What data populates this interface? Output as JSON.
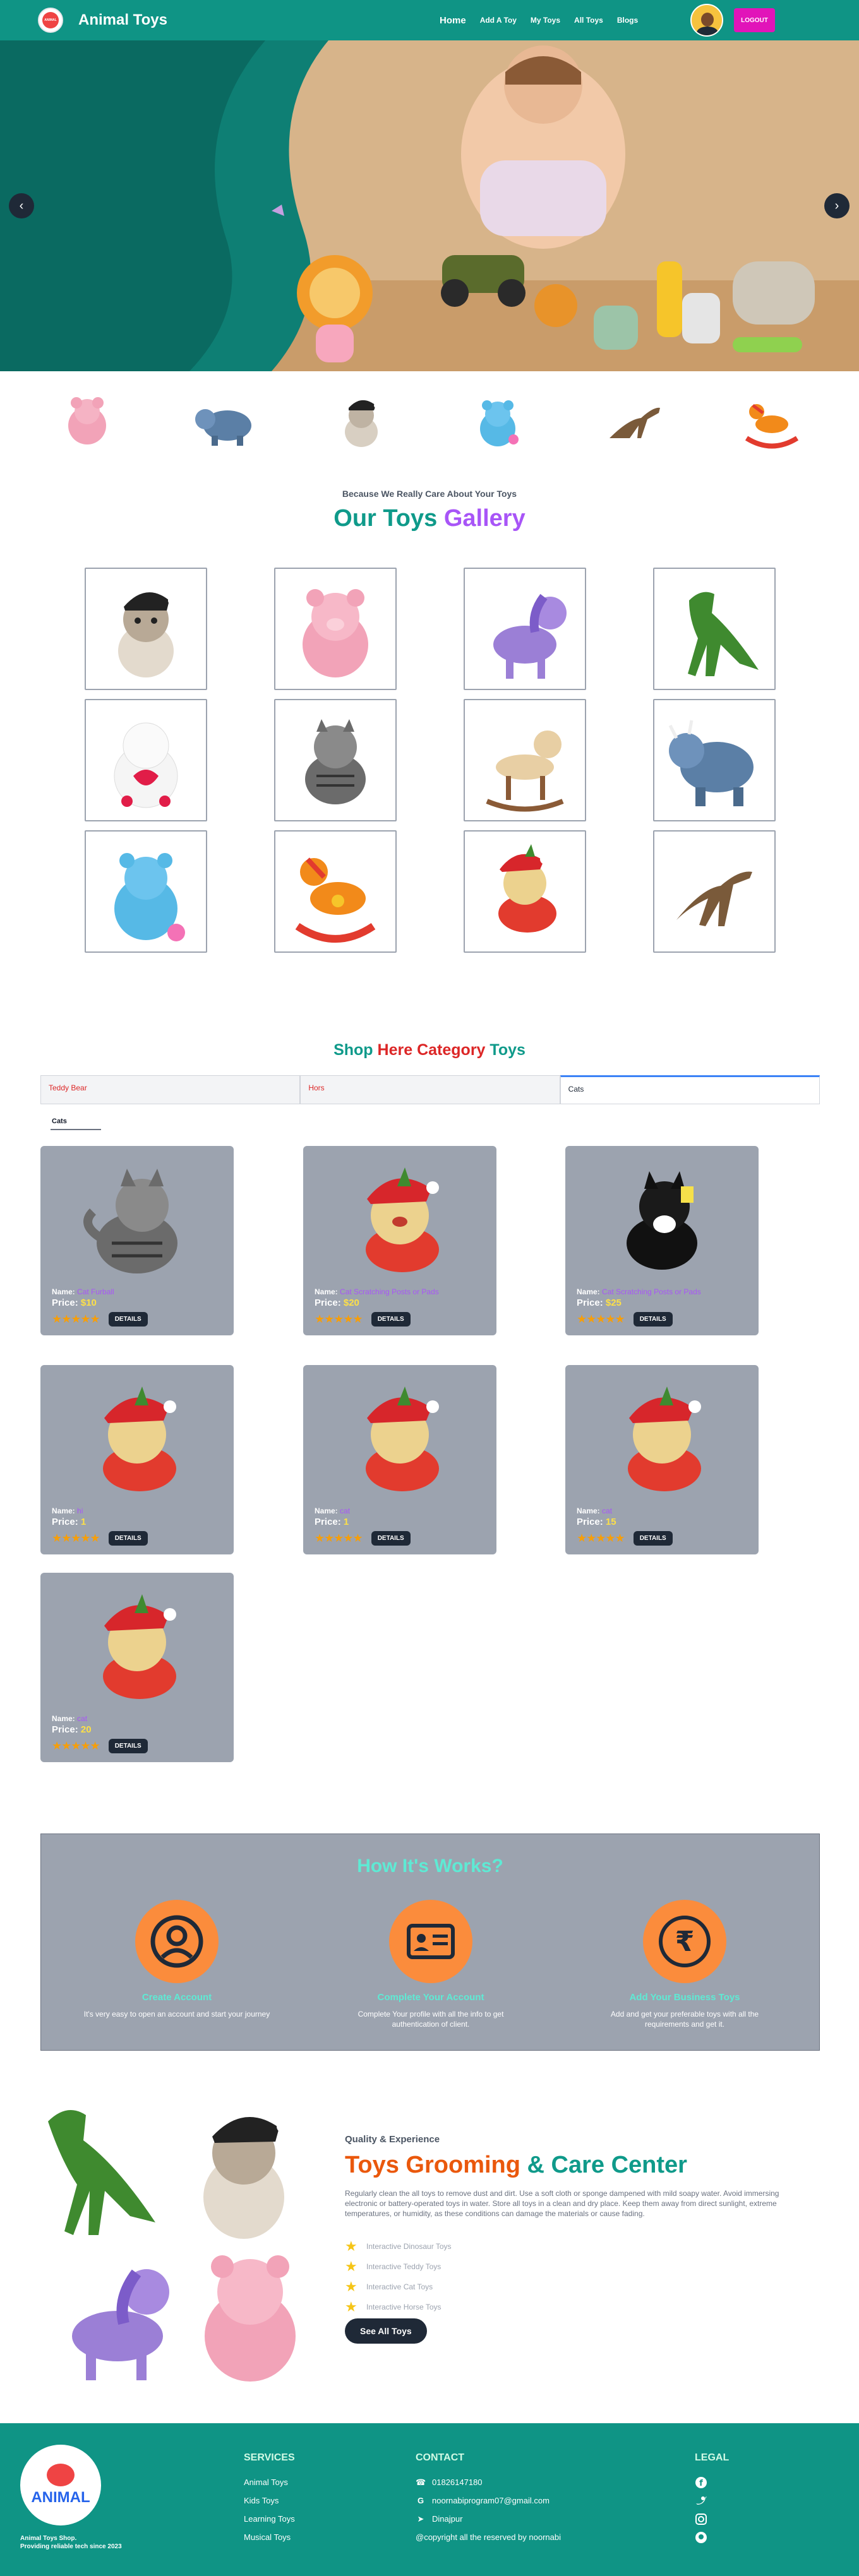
{
  "nav": {
    "brand": "Animal Toys",
    "logo_text": "ANIMAL",
    "links": [
      "Home",
      "Add A Toy",
      "My Toys",
      "All Toys",
      "Blogs"
    ],
    "logout": "LOGOUT"
  },
  "hero": {
    "prev": "‹",
    "next": "›"
  },
  "gallery": {
    "eyebrow": "Because We Really Care About Your Toys",
    "title_a": "Our Toys",
    "title_b": "Gallery"
  },
  "category": {
    "title_a": "Shop",
    "title_b": "Here Category",
    "title_c": "Toys",
    "tabs": [
      "Teddy Bear",
      "Hors",
      "Cats"
    ],
    "subtab": "Cats",
    "cards": [
      {
        "name_label": "Name:",
        "name": "Cat Furball",
        "price_label": "Price:",
        "price": "$10",
        "details": "DETAILS",
        "stars": "★★★★★"
      },
      {
        "name_label": "Name:",
        "name": "Cat Scratching Posts or Pads",
        "price_label": "Price:",
        "price": "$20",
        "details": "DETAILS",
        "stars": "★★★★★"
      },
      {
        "name_label": "Name:",
        "name": "Cat Scratching Posts or Pads",
        "price_label": "Price:",
        "price": "$25",
        "details": "DETAILS",
        "stars": "★★★★★"
      },
      {
        "name_label": "Name:",
        "name": "hi",
        "price_label": "Price:",
        "price": "1",
        "details": "DETAILS",
        "stars": "★★★★★"
      },
      {
        "name_label": "Name:",
        "name": "cat",
        "price_label": "Price:",
        "price": "1",
        "details": "DETAILS",
        "stars": "★★★★★"
      },
      {
        "name_label": "Name:",
        "name": "cat",
        "price_label": "Price:",
        "price": "15",
        "details": "DETAILS",
        "stars": "★★★★★"
      },
      {
        "name_label": "Name:",
        "name": "cat",
        "price_label": "Price:",
        "price": "20",
        "details": "DETAILS",
        "stars": "★★★★★"
      }
    ]
  },
  "how": {
    "title": "How It's Works?",
    "steps": [
      {
        "title": "Create Account",
        "desc": "It's very easy to open an account and start your journey",
        "icon": "user-circle-icon"
      },
      {
        "title": "Complete Your Account",
        "desc": "Complete Your profile with all the info to get authentication of client.",
        "icon": "id-card-icon"
      },
      {
        "title": "Add Your Business Toys",
        "desc": "Add and get your preferable toys with all the requirements and get it.",
        "icon": "rupee-icon"
      }
    ]
  },
  "groom": {
    "eyebrow": "Quality & Experience",
    "title_a": "Toys Grooming",
    "title_b": "& Care Center",
    "desc": "Regularly clean the all toys to remove dust and dirt. Use a soft cloth or sponge dampened with mild soapy water. Avoid immersing electronic or battery-operated toys in water. Store all toys in a clean and dry place. Keep them away from direct sunlight, extreme temperatures, or humidity, as these conditions can damage the materials or cause fading.",
    "bullets": [
      "Interactive Dinosaur Toys",
      "Interactive Teddy Toys",
      "Interactive Cat Toys",
      "Interactive Horse Toys"
    ],
    "button": "See All Toys"
  },
  "footer": {
    "caption_1": "Animal Toys Shop.",
    "caption_2": "Providing reliable tech since 2023",
    "services_title": "SERVICES",
    "services": [
      "Animal Toys",
      "Kids Toys",
      "Learning Toys",
      "Musical Toys"
    ],
    "contact_title": "CONTACT",
    "phone": "01826147180",
    "email": "noornabiprogram07@gmail.com",
    "location": "Dinajpur",
    "copyright": "@copyright all the reserved by noornabi",
    "legal_title": "LEGAL"
  },
  "colors": {
    "primary": "#0f9485",
    "accent": "#e114b9",
    "orange": "#fb8c3c",
    "card": "#9ca3af"
  }
}
